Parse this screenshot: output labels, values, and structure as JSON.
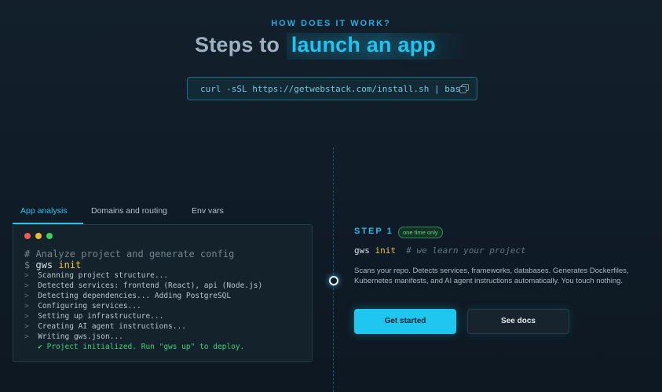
{
  "section": {
    "eyebrow": "HOW DOES IT WORK?",
    "title_prefix": "Steps to",
    "title_accent": "launch an app"
  },
  "install": {
    "command": "curl -sSL https://getwebstack.com/install.sh | bash",
    "copy_icon": "copy-icon"
  },
  "tabs": [
    {
      "label": "App analysis",
      "active": true
    },
    {
      "label": "Domains and routing",
      "active": false
    },
    {
      "label": "Env vars",
      "active": false
    }
  ],
  "terminal": {
    "comment": "# Analyze project and generate config",
    "prompt": "$",
    "command_prefix": "gws",
    "command_keyword": "init",
    "output": [
      "Scanning project structure...",
      "Detected services: frontend (React), api (Node.js)",
      "Detecting dependencies... Adding PostgreSQL",
      "Configuring services...",
      "Setting up infrastructure...",
      "Creating AI agent instructions...",
      "Writing gws.json..."
    ],
    "output_marker": ">",
    "success": "✔ Project initialized. Run \"gws up\" to deploy."
  },
  "step": {
    "label": "STEP 1",
    "badge": "one time only",
    "cmd_prefix": "gws",
    "cmd_keyword": "init",
    "cmd_comment": "# we learn your project",
    "description": "Scans your repo. Detects services, frameworks, databases. Generates Dockerfiles, Kubernetes manifests, and AI agent instructions automatically. You touch nothing."
  },
  "buttons": {
    "primary": "Get started",
    "secondary": "See docs"
  },
  "colors": {
    "accent": "#22c3ee",
    "background": "#0f1b26",
    "keyword": "#f0c24a",
    "success": "#3fcf7a"
  }
}
